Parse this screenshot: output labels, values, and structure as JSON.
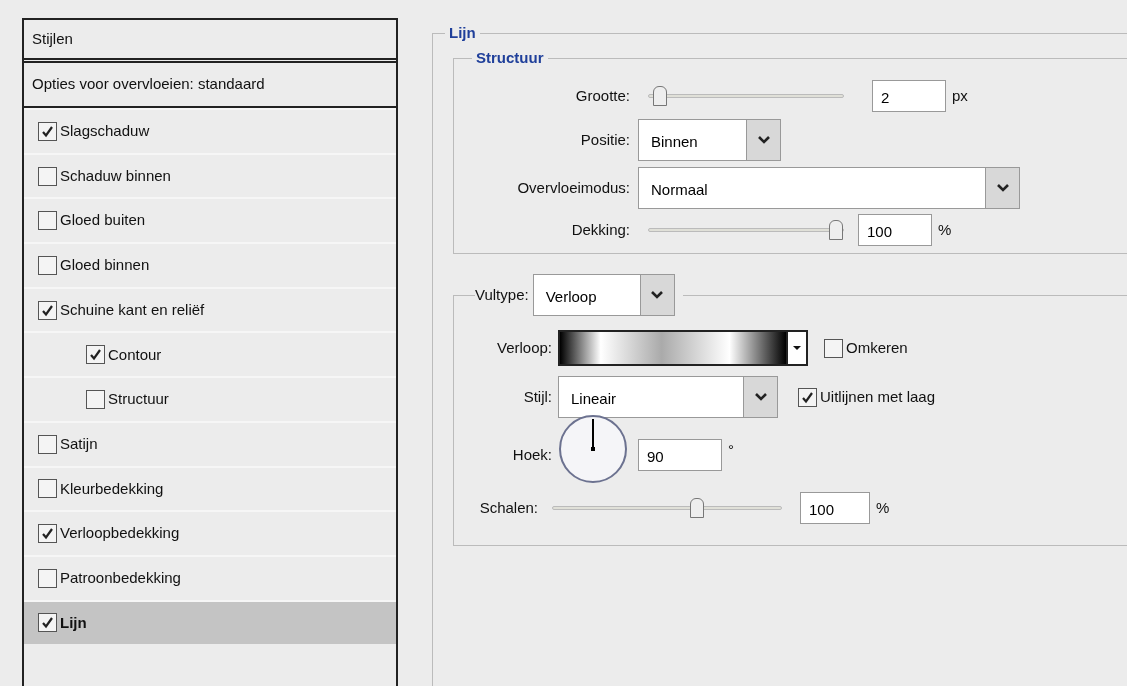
{
  "styles_panel": {
    "title": "Stijlen",
    "blending_options": "Opties voor overvloeien: standaard",
    "items": [
      {
        "label": "Slagschaduw",
        "checked": true,
        "selected": false
      },
      {
        "label": "Schaduw binnen",
        "checked": false,
        "selected": false
      },
      {
        "label": "Gloed buiten",
        "checked": false,
        "selected": false
      },
      {
        "label": "Gloed binnen",
        "checked": false,
        "selected": false
      },
      {
        "label": "Schuine kant en reliëf",
        "checked": true,
        "selected": false,
        "children": [
          {
            "label": "Contour",
            "checked": true,
            "selected": false
          },
          {
            "label": "Structuur",
            "checked": false,
            "selected": false
          }
        ]
      },
      {
        "label": "Satijn",
        "checked": false,
        "selected": false
      },
      {
        "label": "Kleurbedekking",
        "checked": false,
        "selected": false
      },
      {
        "label": "Verloopbedekking",
        "checked": true,
        "selected": false
      },
      {
        "label": "Patroonbedekking",
        "checked": false,
        "selected": false
      },
      {
        "label": "Lijn",
        "checked": true,
        "selected": true
      }
    ]
  },
  "section": {
    "title": "Lijn",
    "structure": {
      "title": "Structuur",
      "size": {
        "label": "Grootte:",
        "level": 0.02,
        "value": "2",
        "unit": "px"
      },
      "position": {
        "label": "Positie:",
        "value": "Binnen"
      },
      "blend_mode": {
        "label": "Overvloeimodus:",
        "value": "Normaal"
      },
      "opacity": {
        "label": "Dekking:",
        "level": 1,
        "value": "100",
        "unit": "%"
      }
    },
    "fill": {
      "fill_type": {
        "label": "Vultype:",
        "value": "Verloop"
      },
      "gradient": {
        "label": "Verloop:"
      },
      "reverse": {
        "label": "Omkeren",
        "checked": false
      },
      "style": {
        "label": "Stijl:",
        "value": "Lineair"
      },
      "align": {
        "label": "Uitlijnen met laag",
        "checked": true
      },
      "angle": {
        "label": "Hoek:",
        "value": "90",
        "unit": "°"
      },
      "scale": {
        "label": "Schalen:",
        "level": 0.64,
        "value": "100",
        "unit": "%"
      }
    }
  }
}
